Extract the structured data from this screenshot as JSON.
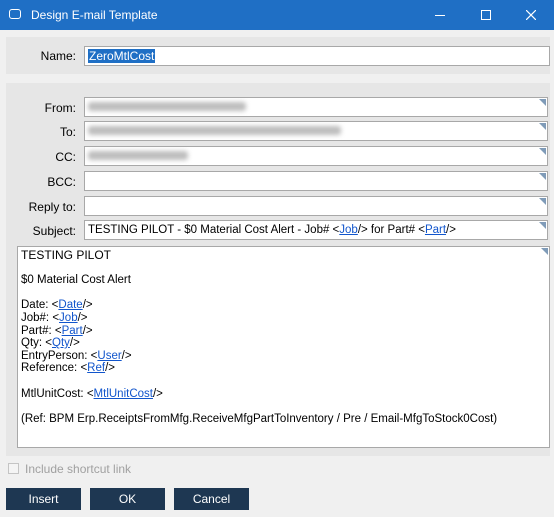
{
  "window": {
    "title": "Design E-mail Template"
  },
  "form": {
    "name_label": "Name:",
    "name_value": "ZeroMtlCost",
    "from_label": "From:",
    "to_label": "To:",
    "cc_label": "CC:",
    "bcc_label": "BCC:",
    "reply_to_label": "Reply to:",
    "subject_label": "Subject:"
  },
  "subject": {
    "prefix": "TESTING PILOT - $0 Material Cost Alert - Job# <",
    "job_token": "Job",
    "mid": "/> for Part# <",
    "part_token": "Part",
    "suffix": "/>"
  },
  "body": {
    "l1": "TESTING PILOT",
    "l2": "$0 Material Cost Alert",
    "date_prefix": "Date: <",
    "date_token": "Date",
    "close": "/>",
    "job_prefix": "Job#: <",
    "job_token": "Job",
    "part_prefix": "Part#: <",
    "part_token": "Part",
    "qty_prefix": "Qty: <",
    "qty_token": "Qty",
    "entry_prefix": "EntryPerson: <",
    "entry_token": "User",
    "ref_prefix": "Reference: <",
    "ref_token": "Ref",
    "mtl_prefix": "MtlUnitCost: <",
    "mtl_token": "MtlUnitCost",
    "footer": "(Ref: BPM Erp.ReceiptsFromMfg.ReceiveMfgPartToInventory / Pre / Email-MfgToStock0Cost)"
  },
  "options": {
    "shortcut_label": "Include shortcut link"
  },
  "buttons": {
    "insert": "Insert",
    "ok": "OK",
    "cancel": "Cancel"
  }
}
